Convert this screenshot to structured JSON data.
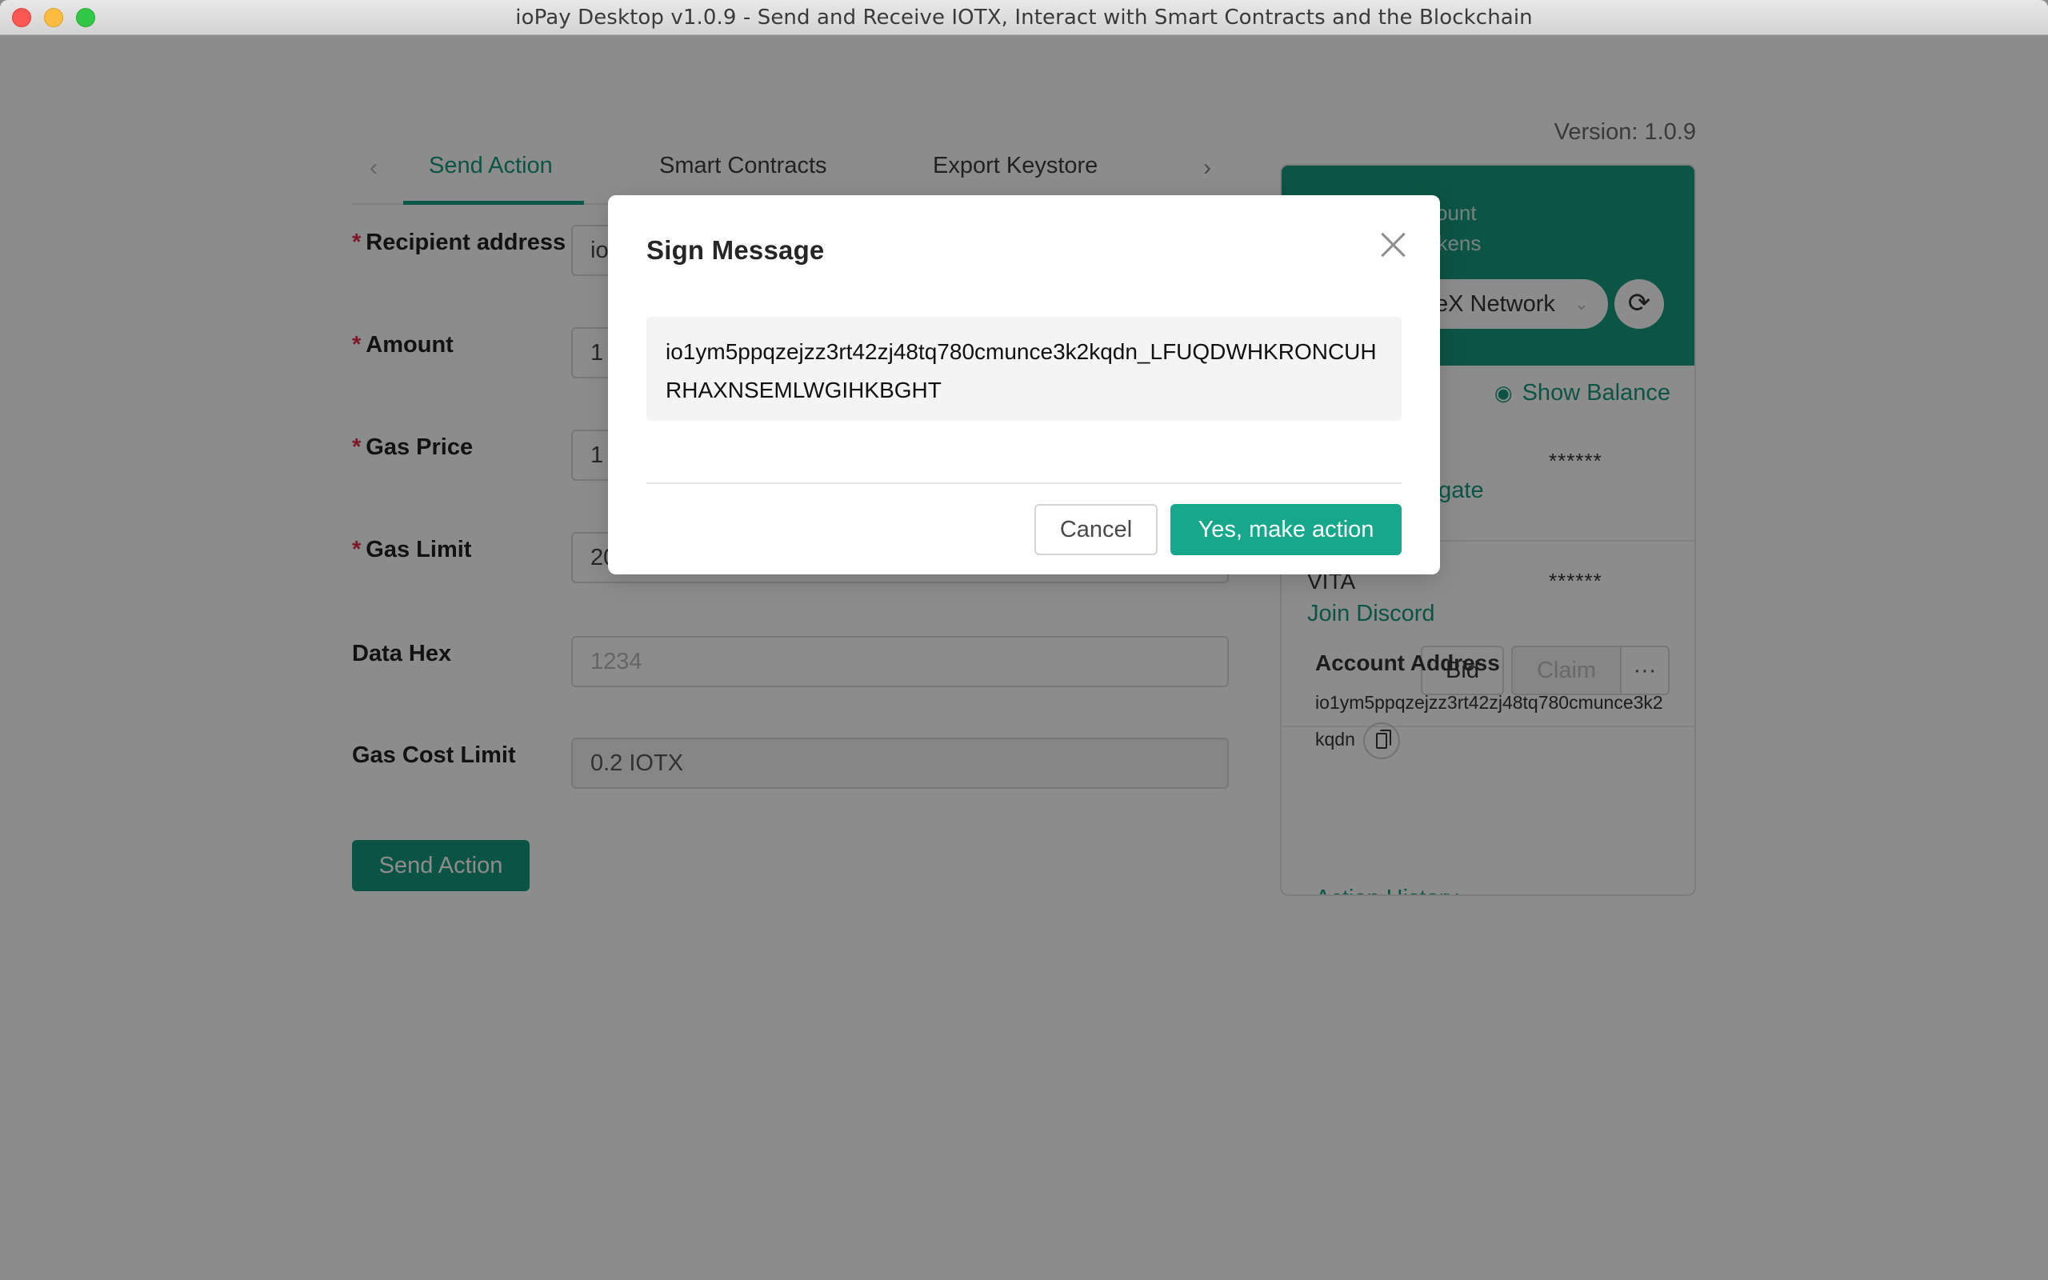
{
  "window": {
    "title": "ioPay Desktop v1.0.9 - Send and Receive IOTX, Interact with Smart Contracts and the Blockchain",
    "controls": [
      "close",
      "minimize",
      "maximize"
    ]
  },
  "tabs": {
    "prev_icon": "chevron-left-icon",
    "next_icon": "chevron-right-icon",
    "items": [
      {
        "label": "Send Action",
        "active": true
      },
      {
        "label": "Smart Contracts",
        "active": false
      },
      {
        "label": "Export Keystore",
        "active": false
      }
    ]
  },
  "version_label": "Version: 1.0.9",
  "form": {
    "fields": [
      {
        "label": "Recipient address",
        "required": true,
        "value": "io",
        "placeholder": ""
      },
      {
        "label": "Amount",
        "required": true,
        "value": "1",
        "placeholder": ""
      },
      {
        "label": "Gas Price",
        "required": true,
        "value": "1",
        "placeholder": ""
      },
      {
        "label": "Gas Limit",
        "required": true,
        "value": "20",
        "placeholder": ""
      },
      {
        "label": "Data Hex",
        "required": false,
        "value": "",
        "placeholder": "1234"
      },
      {
        "label": "Gas Cost Limit",
        "required": false,
        "value": "0.2 IOTX",
        "placeholder": "",
        "disabled": true
      }
    ],
    "required_mark": "*",
    "submit_label": "Send Action"
  },
  "account_card": {
    "header_lines": [
      "count",
      "okens"
    ],
    "network_label": "eX Network",
    "show_balance_label": "Show Balance",
    "assets": [
      {
        "name": "",
        "balance": "******",
        "link": "egate"
      },
      {
        "name": "VITA",
        "balance": "******",
        "link": "Join Discord"
      }
    ],
    "buttons": {
      "bid": "Bid",
      "claim": "Claim",
      "more": "···"
    },
    "address_title": "Account Address",
    "address": "io1ym5ppqzejzz3rt42zj48tq780cmunce3k2kqdn",
    "action_history_label": "Action History"
  },
  "modal": {
    "title": "Sign Message",
    "message": "io1ym5ppqzejzz3rt42zj48tq780cmunce3k2kqdn_LFUQDWHKRONCUHRHAXNSEMLWGIHKBGHT",
    "cancel_label": "Cancel",
    "ok_label": "Yes, make action"
  },
  "colors": {
    "brand": "#159a7f",
    "primary_button": "#17a88b",
    "required_mark": "#e02d44"
  }
}
